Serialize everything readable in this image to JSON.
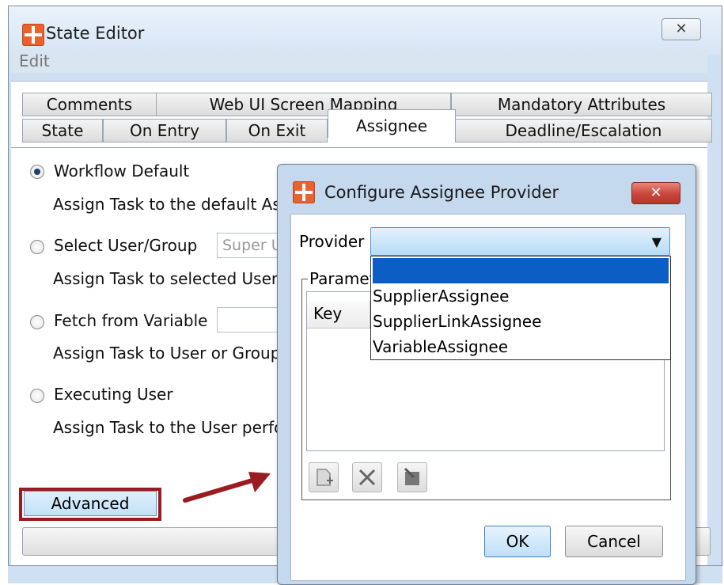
{
  "outer_window": {
    "title": "State Editor",
    "close_label": "✕",
    "menu": [
      "Edit"
    ]
  },
  "tabs_row1": [
    "Comments",
    "Web UI Screen Mapping",
    "Mandatory Attributes"
  ],
  "tabs_row2": [
    "State",
    "On Entry",
    "On Exit",
    "Assignee",
    "Deadline/Escalation"
  ],
  "active_tab": "Assignee",
  "options": [
    {
      "label": "Workflow Default",
      "desc": "Assign Task to the default Ass",
      "checked": true,
      "field": null
    },
    {
      "label": "Select User/Group",
      "desc": "Assign Task to selected User o",
      "checked": false,
      "field": "Super U"
    },
    {
      "label": "Fetch from Variable",
      "desc": "Assign Task to User or Group",
      "checked": false,
      "field": ""
    },
    {
      "label": "Executing User",
      "desc": "Assign Task to the User perfo",
      "checked": false,
      "field": null
    }
  ],
  "advanced_button": "Advanced",
  "dialog": {
    "title": "Configure Assignee Provider",
    "close_label": "✕",
    "provider_label": "Provider",
    "provider_value": "",
    "dropdown_options": [
      "",
      "SupplierAssignee",
      "SupplierLinkAssignee",
      "VariableAssignee"
    ],
    "parameters_label": "Paramet",
    "table_columns": [
      "Key"
    ],
    "ok_label": "OK",
    "cancel_label": "Cancel"
  },
  "colors": {
    "highlight": "#9b1c20",
    "selection": "#0b5fc4"
  }
}
